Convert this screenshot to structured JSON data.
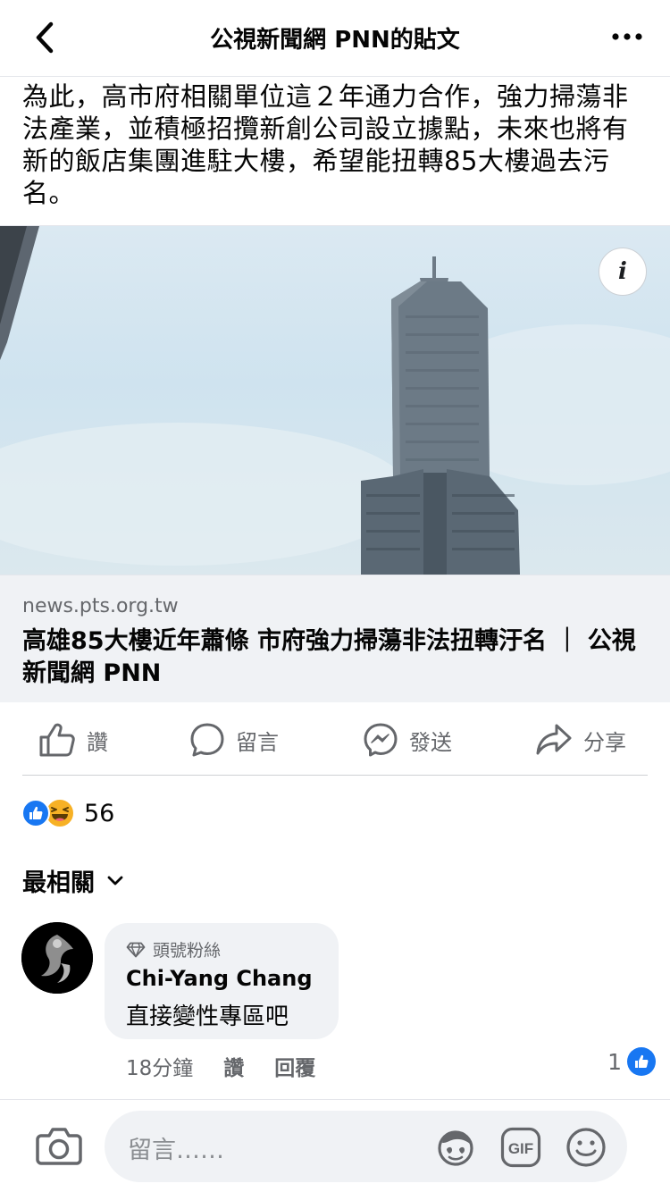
{
  "header": {
    "title": "公視新聞網 PNN的貼文"
  },
  "post": {
    "text": "為此，高市府相關單位這２年通力合作，強力掃蕩非法產業，並積極招攬新創公司設立據點，未來也將有新的飯店集團進駐大樓，希望能扭轉85大樓過去污名。"
  },
  "link": {
    "domain": "news.pts.org.tw",
    "title": "高雄85大樓近年蕭條 市府強力掃蕩非法扭轉汙名 ｜ 公視新聞網 PNN",
    "info_icon": "i"
  },
  "actions": {
    "like": "讚",
    "comment": "留言",
    "send": "發送",
    "share": "分享"
  },
  "reactions": {
    "count": "56",
    "types": [
      "like",
      "haha"
    ]
  },
  "sort": {
    "label": "最相關"
  },
  "comment": {
    "badge": "頭號粉絲",
    "name": "Chi-Yang Chang",
    "text": "直接變性專區吧",
    "time": "18分鐘",
    "like_label": "讚",
    "reply_label": "回覆",
    "like_count": "1"
  },
  "compose": {
    "placeholder": "留言……",
    "icons": [
      "camera-icon",
      "avatar-sticker-icon",
      "gif-icon",
      "emoji-icon"
    ]
  },
  "colors": {
    "brand_blue": "#1877f2",
    "secondary_text": "#65676b",
    "bubble_bg": "#f0f2f5"
  }
}
